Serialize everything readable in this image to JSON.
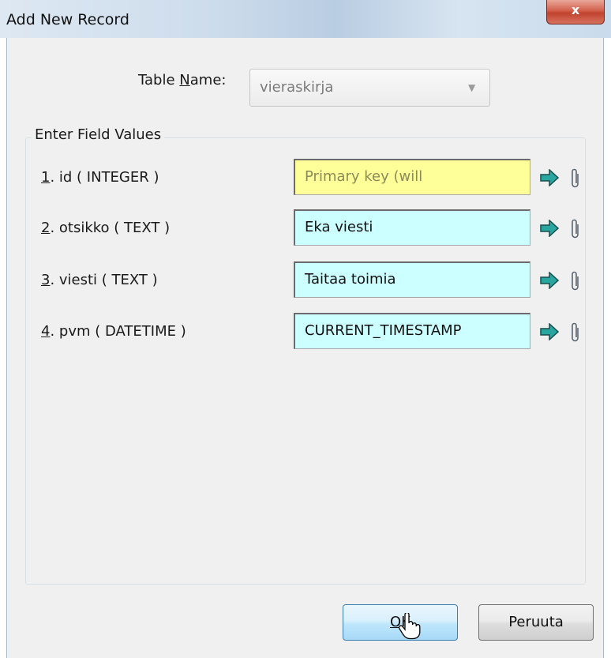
{
  "window": {
    "title": "Add New Record",
    "close_glyph": "x"
  },
  "table_name": {
    "label_before": "Table ",
    "label_mnemonic": "N",
    "label_after": "ame:",
    "value": "vieraskirja"
  },
  "group": {
    "legend": "Enter Field Values"
  },
  "fields": [
    {
      "num": "1",
      "rest": ". id ( INTEGER )",
      "value": "Primary key (will",
      "kind": "primary-key"
    },
    {
      "num": "2",
      "rest": ". otsikko ( TEXT )",
      "value": "Eka viesti",
      "kind": "text"
    },
    {
      "num": "3",
      "rest": ". viesti ( TEXT )",
      "value": "Taitaa toimia",
      "kind": "text"
    },
    {
      "num": "4",
      "rest": ". pvm ( DATETIME )",
      "value": "CURRENT_TIMESTAMP",
      "kind": "text"
    }
  ],
  "buttons": {
    "ok_mnemonic": "O",
    "ok_rest": "K",
    "cancel": "Peruuta"
  },
  "icons": {
    "arrow": "right-arrow-icon",
    "attach": "paperclip-icon"
  },
  "colors": {
    "primary_key_bg": "#ffff99",
    "field_bg": "#ccffff",
    "arrow_fill": "#2aa6a0"
  }
}
